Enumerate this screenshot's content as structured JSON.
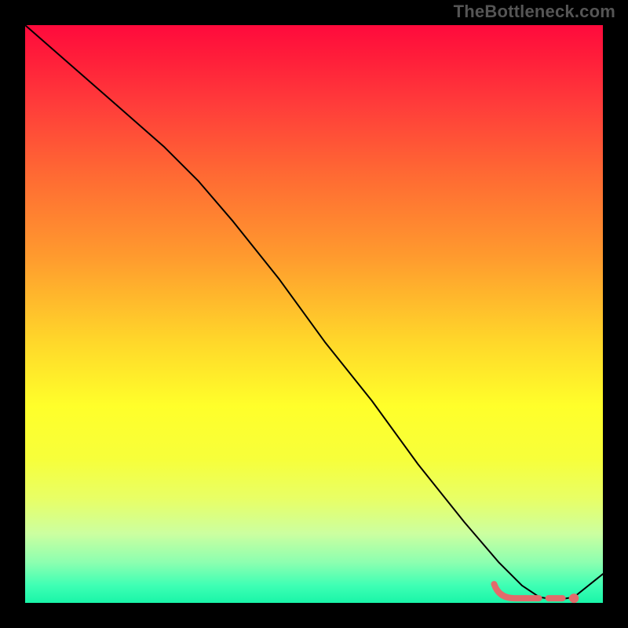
{
  "watermark": "TheBottleneck.com",
  "colors": {
    "page_bg": "#000000",
    "curve": "#000000",
    "accent": "#e26b6b"
  },
  "chart_data": {
    "type": "line",
    "title": "",
    "xlabel": "",
    "ylabel": "",
    "xlim": [
      0,
      100
    ],
    "ylim": [
      0,
      100
    ],
    "grid": false,
    "legend": false,
    "series": [
      {
        "name": "bottleneck-curve",
        "x": [
          0,
          8,
          16,
          24,
          30,
          36,
          44,
          52,
          60,
          68,
          76,
          82,
          86,
          89,
          92,
          95,
          100
        ],
        "y": [
          100,
          93,
          86,
          79,
          73,
          66,
          56,
          45,
          35,
          24,
          14,
          7,
          3,
          1,
          0.5,
          1,
          5
        ]
      }
    ],
    "highlight": {
      "name": "optimal-range",
      "x_start": 82,
      "x_end": 95,
      "y": 0.8
    }
  }
}
